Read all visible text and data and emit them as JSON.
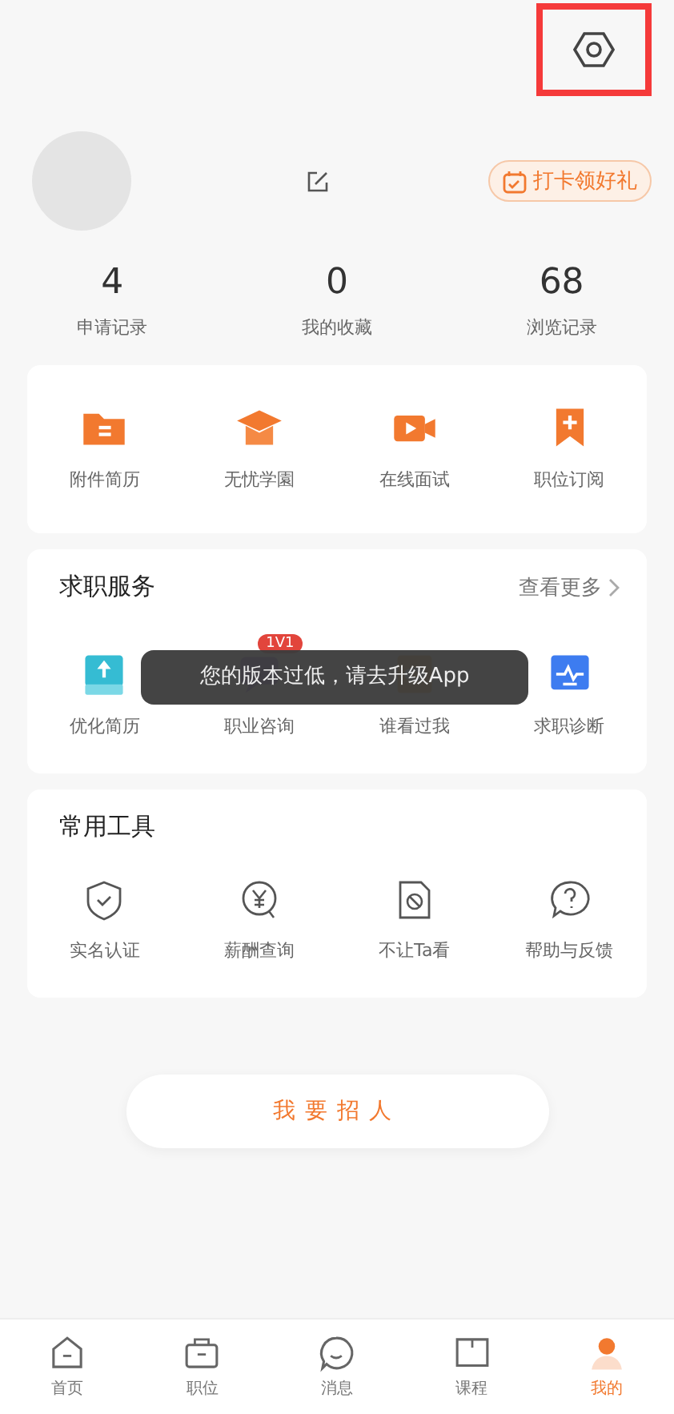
{
  "header": {
    "checkin_button": "打卡领好礼",
    "highlighted_settings": true
  },
  "stats": [
    {
      "value": "4",
      "label": "申请记录"
    },
    {
      "value": "0",
      "label": "我的收藏"
    },
    {
      "value": "68",
      "label": "浏览记录"
    }
  ],
  "shortcuts": [
    {
      "kind": "folder",
      "label": "附件简历"
    },
    {
      "kind": "cap",
      "label": "无忧学園"
    },
    {
      "kind": "video",
      "label": "在线面试"
    },
    {
      "kind": "bookmark",
      "label": "职位订阅"
    }
  ],
  "job_services": {
    "title": "求职服务",
    "more": "查看更多",
    "items": [
      {
        "kind": "upload",
        "label": "优化简历"
      },
      {
        "kind": "chat",
        "label": "职业咨询",
        "badge": "1V1"
      },
      {
        "kind": "eye",
        "label": "谁看过我"
      },
      {
        "kind": "pulse",
        "label": "求职诊断"
      }
    ]
  },
  "toast": {
    "text": "您的版本过低，请去升级App"
  },
  "tools": {
    "title": "常用工具",
    "items": [
      {
        "kind": "shield",
        "label": "实名认证"
      },
      {
        "kind": "yen",
        "label": "薪酬查询"
      },
      {
        "kind": "block",
        "label": "不让Ta看"
      },
      {
        "kind": "help",
        "label": "帮助与反馈"
      }
    ]
  },
  "recruit_button": "我要招人",
  "tabs": [
    {
      "kind": "home",
      "label": "首页",
      "selected": false
    },
    {
      "kind": "bag",
      "label": "职位",
      "selected": false
    },
    {
      "kind": "chat",
      "label": "消息",
      "selected": false
    },
    {
      "kind": "book",
      "label": "课程",
      "selected": false
    },
    {
      "kind": "person",
      "label": "我的",
      "selected": true
    }
  ]
}
